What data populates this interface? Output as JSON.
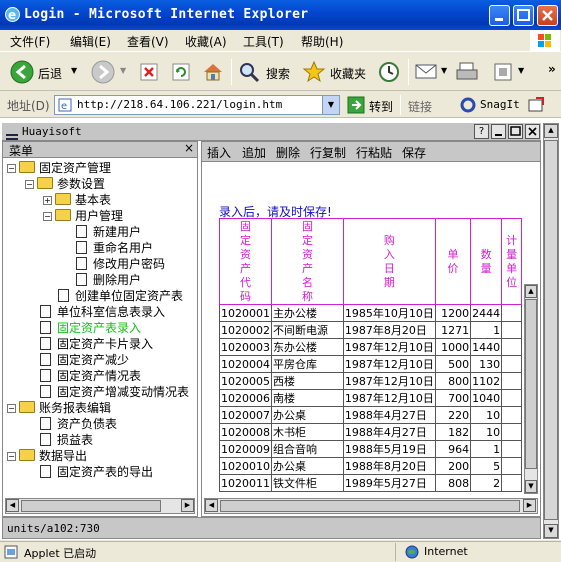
{
  "window": {
    "title": "Login - Microsoft Internet Explorer"
  },
  "menu": [
    "文件(F)",
    "编辑(E)",
    "查看(V)",
    "收藏(A)",
    "工具(T)",
    "帮助(H)"
  ],
  "toolbar": {
    "back": "后退",
    "search": "搜索",
    "favorites": "收藏夹"
  },
  "address": {
    "label": "地址(D)",
    "url": "http://218.64.106.221/login.htm",
    "go": "转到",
    "links": "链接",
    "snagit": "SnagIt"
  },
  "applet": {
    "title": "Huayisoft",
    "help": "?",
    "menu_header": "菜单",
    "status": "units/a102:730"
  },
  "tree": [
    {
      "label": "固定资产管理",
      "type": "folder",
      "level": 0,
      "toggle": "−"
    },
    {
      "label": "参数设置",
      "type": "folder",
      "level": 1,
      "toggle": "−"
    },
    {
      "label": "基本表",
      "type": "folder",
      "level": 2,
      "toggle": "+"
    },
    {
      "label": "用户管理",
      "type": "folder",
      "level": 2,
      "toggle": "−"
    },
    {
      "label": "新建用户",
      "type": "doc",
      "level": 3
    },
    {
      "label": "重命名用户",
      "type": "doc",
      "level": 3
    },
    {
      "label": "修改用户密码",
      "type": "doc",
      "level": 3
    },
    {
      "label": "删除用户",
      "type": "doc",
      "level": 3
    },
    {
      "label": "创建单位固定资产表",
      "type": "doc",
      "level": 2
    },
    {
      "label": "单位科室信息表录入",
      "type": "doc",
      "level": 1
    },
    {
      "label": "固定资产表录入",
      "type": "doc",
      "level": 1,
      "selected": true
    },
    {
      "label": "固定资产卡片录入",
      "type": "doc",
      "level": 1
    },
    {
      "label": "固定资产减少",
      "type": "doc",
      "level": 1
    },
    {
      "label": "固定资产情况表",
      "type": "doc",
      "level": 1
    },
    {
      "label": "固定资产增减变动情况表",
      "type": "doc",
      "level": 1
    },
    {
      "label": "账务报表编辑",
      "type": "folder",
      "level": 0,
      "toggle": "−"
    },
    {
      "label": "资产负债表",
      "type": "doc",
      "level": 1
    },
    {
      "label": "损益表",
      "type": "doc",
      "level": 1
    },
    {
      "label": "数据导出",
      "type": "folder",
      "level": 0,
      "toggle": "−"
    },
    {
      "label": "固定资产表的导出",
      "type": "doc",
      "level": 1
    }
  ],
  "actions": [
    "插入",
    "追加",
    "删除",
    "行复制",
    "行粘贴",
    "保存"
  ],
  "notice": "录入后，请及时保存!",
  "table": {
    "headers": [
      "固定资产代码",
      "固定资产名称",
      "购入日期",
      "单价",
      "数量",
      "计量单位"
    ],
    "rows": [
      [
        "1020001",
        "主办公楼",
        "1985年10月10日",
        "1200",
        "2444"
      ],
      [
        "1020002",
        "不间断电源",
        "1987年8月20日",
        "1271",
        "1"
      ],
      [
        "1020003",
        "东办公楼",
        "1987年12月10日",
        "1000",
        "1440"
      ],
      [
        "1020004",
        "平房仓库",
        "1987年12月10日",
        "500",
        "130"
      ],
      [
        "1020005",
        "西楼",
        "1987年12月10日",
        "800",
        "1102"
      ],
      [
        "1020006",
        "南楼",
        "1987年12月10日",
        "700",
        "1040"
      ],
      [
        "1020007",
        "办公桌",
        "1988年4月27日",
        "220",
        "10"
      ],
      [
        "1020008",
        "木书柜",
        "1988年4月27日",
        "182",
        "10"
      ],
      [
        "1020009",
        "组合音响",
        "1988年5月19日",
        "964",
        "1"
      ],
      [
        "1020010",
        "办公桌",
        "1988年8月20日",
        "200",
        "5"
      ],
      [
        "1020011",
        "铁文件柜",
        "1989年5月27日",
        "808",
        "2"
      ]
    ]
  },
  "statusbar": {
    "left": "Applet 已启动",
    "right": "Internet"
  }
}
